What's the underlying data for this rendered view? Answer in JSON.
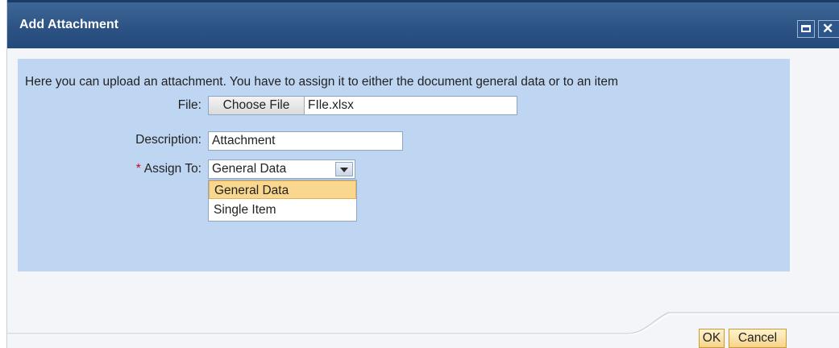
{
  "dialog": {
    "title": "Add Attachment"
  },
  "form": {
    "intro_text": "Here you can upload an attachment. You have to assign it to either the document general data or to an item",
    "file": {
      "label": "File:",
      "button_label": "Choose File",
      "file_name": "FIle.xlsx"
    },
    "description": {
      "label": "Description:",
      "value": "Attachment"
    },
    "assign_to": {
      "required_marker": "*",
      "label": "Assign To:",
      "selected": "General Data",
      "options": [
        "General Data",
        "Single Item"
      ]
    }
  },
  "buttons": {
    "ok": "OK",
    "cancel": "Cancel"
  },
  "colors": {
    "titlebar": "#2c5384",
    "panel": "#bfd6f2",
    "highlight": "#f9d78e",
    "required": "#d6001c"
  }
}
